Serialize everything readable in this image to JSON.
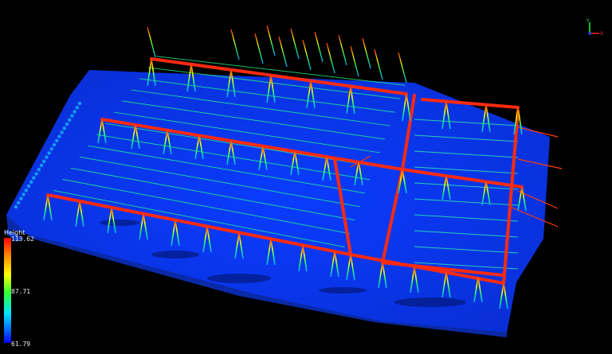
{
  "legend": {
    "title": "Height",
    "max": "113.62",
    "mid": "87.71",
    "min": "61.79"
  },
  "axis_labels": {
    "y": "Y",
    "x": "X"
  },
  "colors": {
    "background": "#000000",
    "ground": "#0a3cff",
    "gantry": "#ff2a10",
    "low": "#0000ff",
    "high": "#ff0000"
  },
  "icons": {
    "axis_gizmo": "xyz-axis-icon"
  }
}
